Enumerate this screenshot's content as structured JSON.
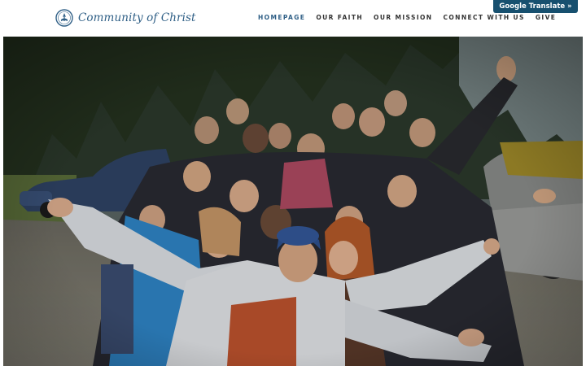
{
  "header": {
    "logo_text": "Community of Christ",
    "nav": [
      {
        "label": "HOMEPAGE",
        "active": true
      },
      {
        "label": "OUR FAITH",
        "active": false
      },
      {
        "label": "OUR MISSION",
        "active": false
      },
      {
        "label": "CONNECT WITH US",
        "active": false
      },
      {
        "label": "GIVE",
        "active": false
      }
    ],
    "translate_label": "Google Translate »"
  },
  "colors": {
    "brand_blue": "#2f5f86",
    "translate_bg": "#17506f",
    "nav_text": "#333333"
  },
  "hero": {
    "icon": "group-photo-image"
  }
}
